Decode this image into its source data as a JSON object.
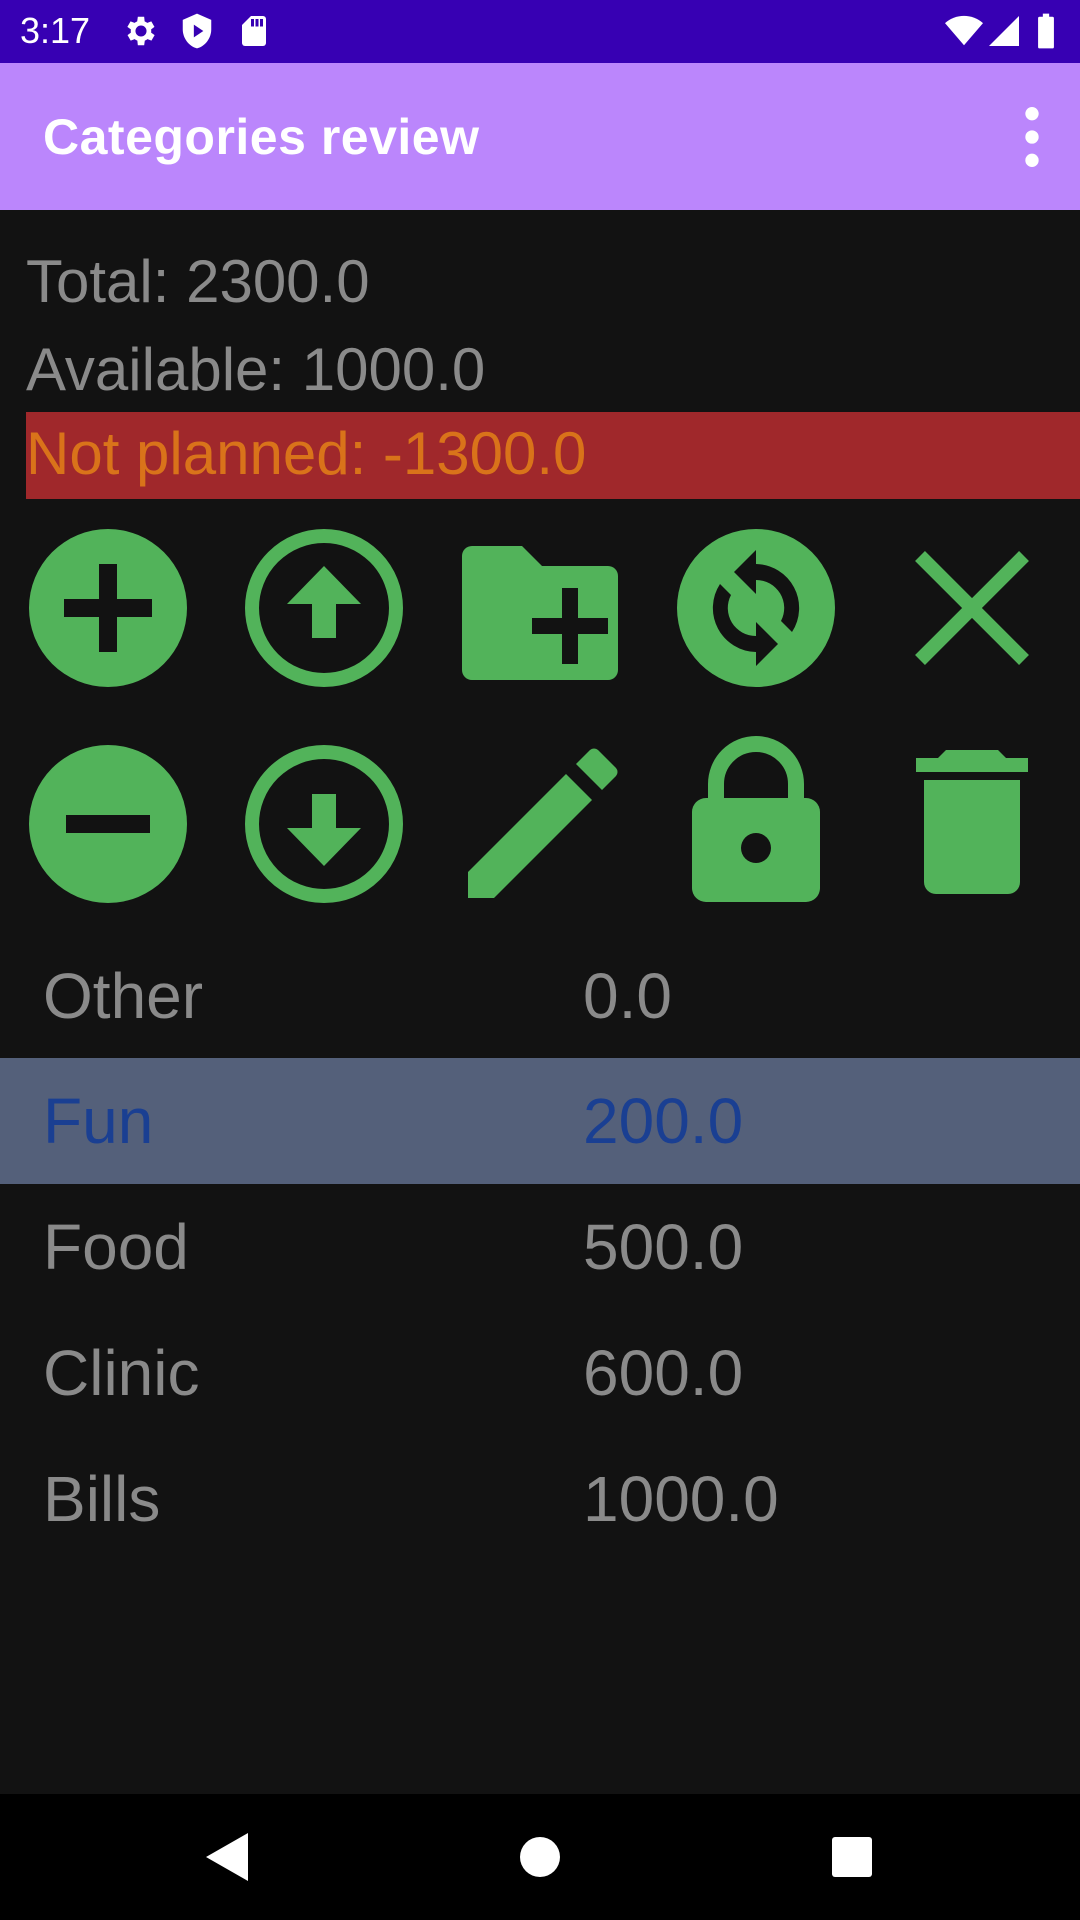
{
  "status_bar": {
    "time": "3:17",
    "icons_left": [
      "gear-icon",
      "shield-play-icon",
      "sd-card-icon"
    ],
    "icons_right": [
      "wifi-icon",
      "cell-signal-icon",
      "battery-icon"
    ]
  },
  "app_bar": {
    "title": "Categories review",
    "menu_icon": "more-vert-icon"
  },
  "summary": {
    "total": "Total: 2300.0",
    "available": "Available: 1000.0",
    "not_planned": "Not planned: -1300.0"
  },
  "actions": {
    "row1": [
      "add-circle-icon",
      "arrow-up-circle-icon",
      "create-folder-icon",
      "sync-icon",
      "close-icon"
    ],
    "row2": [
      "remove-circle-icon",
      "arrow-down-circle-icon",
      "edit-pencil-icon",
      "lock-icon",
      "delete-icon"
    ]
  },
  "categories": [
    {
      "name": "Other",
      "value": "0.0",
      "selected": false
    },
    {
      "name": "Fun",
      "value": "200.0",
      "selected": true
    },
    {
      "name": "Food",
      "value": "500.0",
      "selected": false
    },
    {
      "name": "Clinic",
      "value": "600.0",
      "selected": false
    },
    {
      "name": "Bills",
      "value": "1000.0",
      "selected": false
    }
  ],
  "nav_bar": {
    "icons": [
      "back-icon",
      "home-icon",
      "recents-icon"
    ]
  },
  "colors": {
    "status_bar": "#3700b3",
    "app_bar": "#bb86fc",
    "background": "#121212",
    "accent_green": "#52b35a",
    "warning_bg": "#a0282b",
    "warning_text": "#d9731a",
    "selected_row": "#54607a",
    "selected_text": "#1a3f92",
    "text_gray": "#8a8a8a"
  }
}
